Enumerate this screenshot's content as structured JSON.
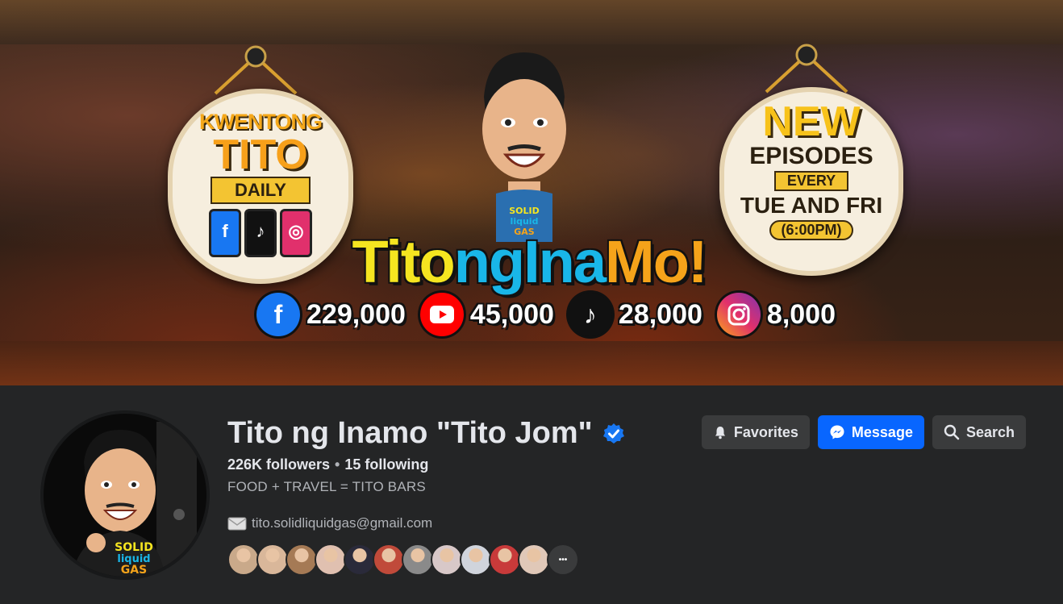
{
  "cover": {
    "left_badge": {
      "line1": "KWENTONG",
      "line2": "TITO",
      "line3": "DAILY"
    },
    "right_badge": {
      "line1": "NEW",
      "line2": "EPISODES",
      "line3": "EVERY",
      "line4": "TUE AND FRI",
      "line5": "(6:00PM)"
    },
    "brand": {
      "part1": "Tito",
      "part2": "ngIna",
      "part3": "Mo!"
    },
    "mascot_shirt": "SOLID LIQUID GAS",
    "stats": [
      {
        "icon": "facebook-icon",
        "value": "229,000",
        "color": "#1877f2"
      },
      {
        "icon": "youtube-icon",
        "value": "45,000",
        "color": "#ff0000"
      },
      {
        "icon": "tiktok-icon",
        "value": "28,000",
        "color": "#111111"
      },
      {
        "icon": "instagram-icon",
        "value": "8,000",
        "color": "#e1306c"
      }
    ]
  },
  "profile": {
    "name": "Tito ng Inamo \"Tito Jom\"",
    "followers": "226K followers",
    "following": "15 following",
    "bio": "FOOD + TRAVEL = TITO BARS",
    "email": "tito.solidliquidgas@gmail.com",
    "avatar_shirt": "SOLID LIQUID GAS",
    "friend_colors": [
      "#c9a98a",
      "#d9b79a",
      "#a57a55",
      "#e0c0b0",
      "#2a2a3a",
      "#c04a3a",
      "#8a8a8a",
      "#d8c8c8",
      "#d0d4dc",
      "#c83a3a",
      "#e0c8b8"
    ]
  },
  "actions": {
    "favorites": "Favorites",
    "message": "Message",
    "search": "Search"
  },
  "colors": {
    "background": "#242526",
    "primary_button": "#0866ff",
    "secondary_button": "#3a3b3c",
    "verified": "#1877f2"
  }
}
